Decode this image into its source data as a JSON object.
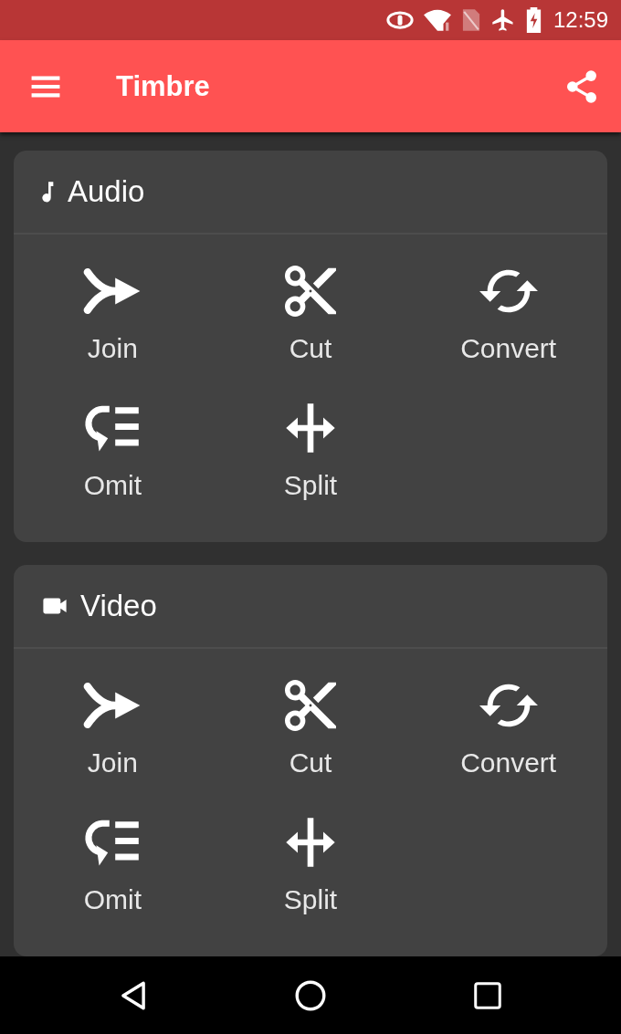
{
  "status_bar": {
    "time": "12:59"
  },
  "app_bar": {
    "title": "Timbre"
  },
  "sections": [
    {
      "title": "Audio",
      "kind": "audio",
      "tools": [
        {
          "label": "Join",
          "kind": "join"
        },
        {
          "label": "Cut",
          "kind": "cut"
        },
        {
          "label": "Convert",
          "kind": "convert"
        },
        {
          "label": "Omit",
          "kind": "omit"
        },
        {
          "label": "Split",
          "kind": "split"
        }
      ]
    },
    {
      "title": "Video",
      "kind": "video",
      "tools": [
        {
          "label": "Join",
          "kind": "join"
        },
        {
          "label": "Cut",
          "kind": "cut"
        },
        {
          "label": "Convert",
          "kind": "convert"
        },
        {
          "label": "Omit",
          "kind": "omit"
        },
        {
          "label": "Split",
          "kind": "split"
        }
      ]
    }
  ]
}
